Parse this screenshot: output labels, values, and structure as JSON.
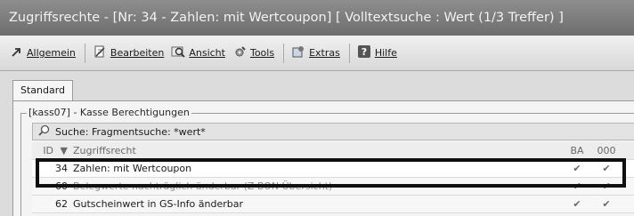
{
  "window": {
    "title": "Zugriffsrechte - [Nr: 34 - Zahlen: mit Wertcoupon] [ Volltextsuche : Wert (1/3 Treffer) ]"
  },
  "menu": {
    "items": [
      {
        "label": "Allgemein",
        "icon": "pin-arrow-icon"
      },
      {
        "label": "Bearbeiten",
        "icon": "document-edit-icon"
      },
      {
        "label": "Ansicht",
        "icon": "magnifier-view-icon"
      },
      {
        "label": "Tools",
        "icon": "gear-tools-icon"
      },
      {
        "label": "Extras",
        "icon": "extras-icon"
      },
      {
        "label": "Hilfe",
        "icon": "help-icon"
      }
    ]
  },
  "tabs": [
    "Standard"
  ],
  "group": {
    "title": "[kass07] - Kasse Berechtigungen"
  },
  "search": {
    "text": "Suche:  Fragmentsuche: *wert*"
  },
  "table": {
    "columns": [
      "ID",
      "Zugriffsrecht",
      "BA",
      "000"
    ],
    "rows": [
      {
        "id": "34",
        "name": "Zahlen: mit Wertcoupon",
        "ba": "✔",
        "ooo": "✔"
      },
      {
        "id": "60",
        "name": "Belegwerte nachträglich änderbar (Z-BON Übersicht)",
        "ba": "✔",
        "ooo": "✔"
      },
      {
        "id": "62",
        "name": "Gutscheinwert in GS-Info änderbar",
        "ba": "✔",
        "ooo": "✔"
      }
    ]
  },
  "colors": {
    "titlebar": "#7d7d7d",
    "highlight_border": "#101010"
  }
}
